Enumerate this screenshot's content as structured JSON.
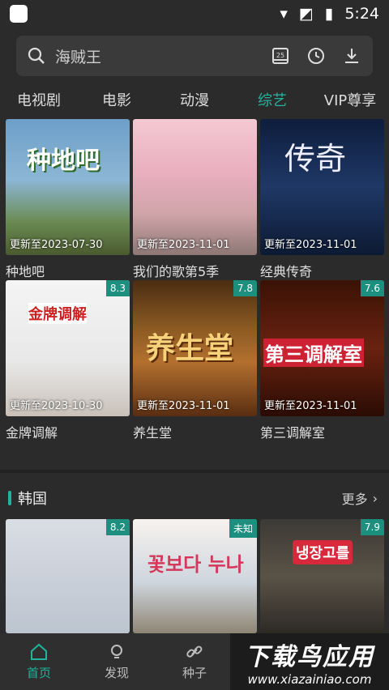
{
  "status": {
    "time": "5:24"
  },
  "search": {
    "placeholder": "海贼王"
  },
  "tabs": [
    "电视剧",
    "电影",
    "动漫",
    "综艺",
    "VIP尊享"
  ],
  "active_tab": "综艺",
  "grid": [
    {
      "title": "种地吧",
      "update": "更新至2023-07-30",
      "rating": "",
      "overlay": "元气森林 种地吧 少年篇"
    },
    {
      "title": "我们的歌第5季",
      "update": "更新至2023-11-01",
      "rating": "",
      "overlay": ""
    },
    {
      "title": "经典传奇",
      "update": "更新至2023-11-01",
      "rating": "",
      "overlay": "传奇 经典 CLASSICAL LEGEND"
    },
    {
      "title": "金牌调解",
      "update": "更新至2023-10-30",
      "rating": "8.3",
      "overlay": "金牌调解 有问题 来调解 来调解 没问题"
    },
    {
      "title": "养生堂",
      "update": "更新至2023-11-01",
      "rating": "7.8",
      "overlay": "养生堂"
    },
    {
      "title": "第三调解室",
      "update": "更新至2023-11-01",
      "rating": "7.6",
      "overlay": "第三调解室"
    }
  ],
  "section": {
    "name": "韩国",
    "more": "更多"
  },
  "korea": [
    {
      "rating": "8.2"
    },
    {
      "rating": "未知",
      "overlay": "꽃보다 누나"
    },
    {
      "rating": "7.9",
      "overlay": "냉장고를 부탁해"
    }
  ],
  "nav": [
    "首页",
    "发现",
    "种子"
  ],
  "watermark": {
    "line1": "下载鸟应用",
    "line2": "www.xiazainiao.com"
  },
  "colors": {
    "accent": "#22b39d",
    "bg": "#2b2b2b"
  }
}
